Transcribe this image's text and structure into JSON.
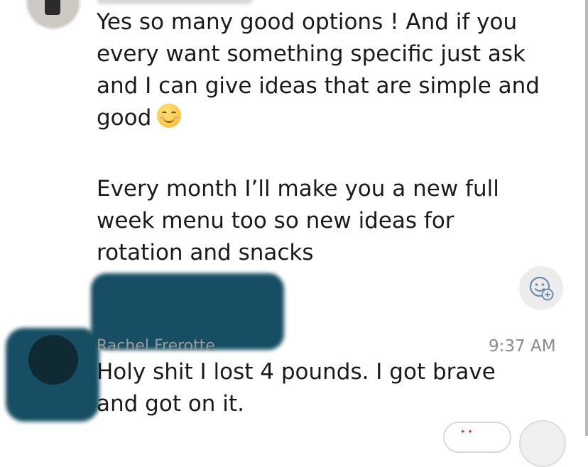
{
  "messages": [
    {
      "lines": [
        "Yes so many good options ! And if you",
        "every want something specific just ask",
        "and I can give ideas that are simple and",
        "good"
      ],
      "emoji": "smiling-face-emoji"
    },
    {
      "lines": [
        "Every month I’ll make you a new full",
        "week menu too so new ideas for",
        "rotation and snacks"
      ]
    },
    {
      "sender": "Rachel Frerotte",
      "timestamp": "9:37 AM",
      "lines": [
        "Holy shit I lost 4 pounds. I got brave",
        "and got on it."
      ]
    }
  ],
  "icons": {
    "reaction": "add-reaction-icon",
    "avatar_top": "user-avatar",
    "avatar_bottom": "user-avatar"
  },
  "colors": {
    "redaction": "#174e63",
    "reaction_button": "#ececec",
    "timestamp": "#8a8a8a"
  }
}
